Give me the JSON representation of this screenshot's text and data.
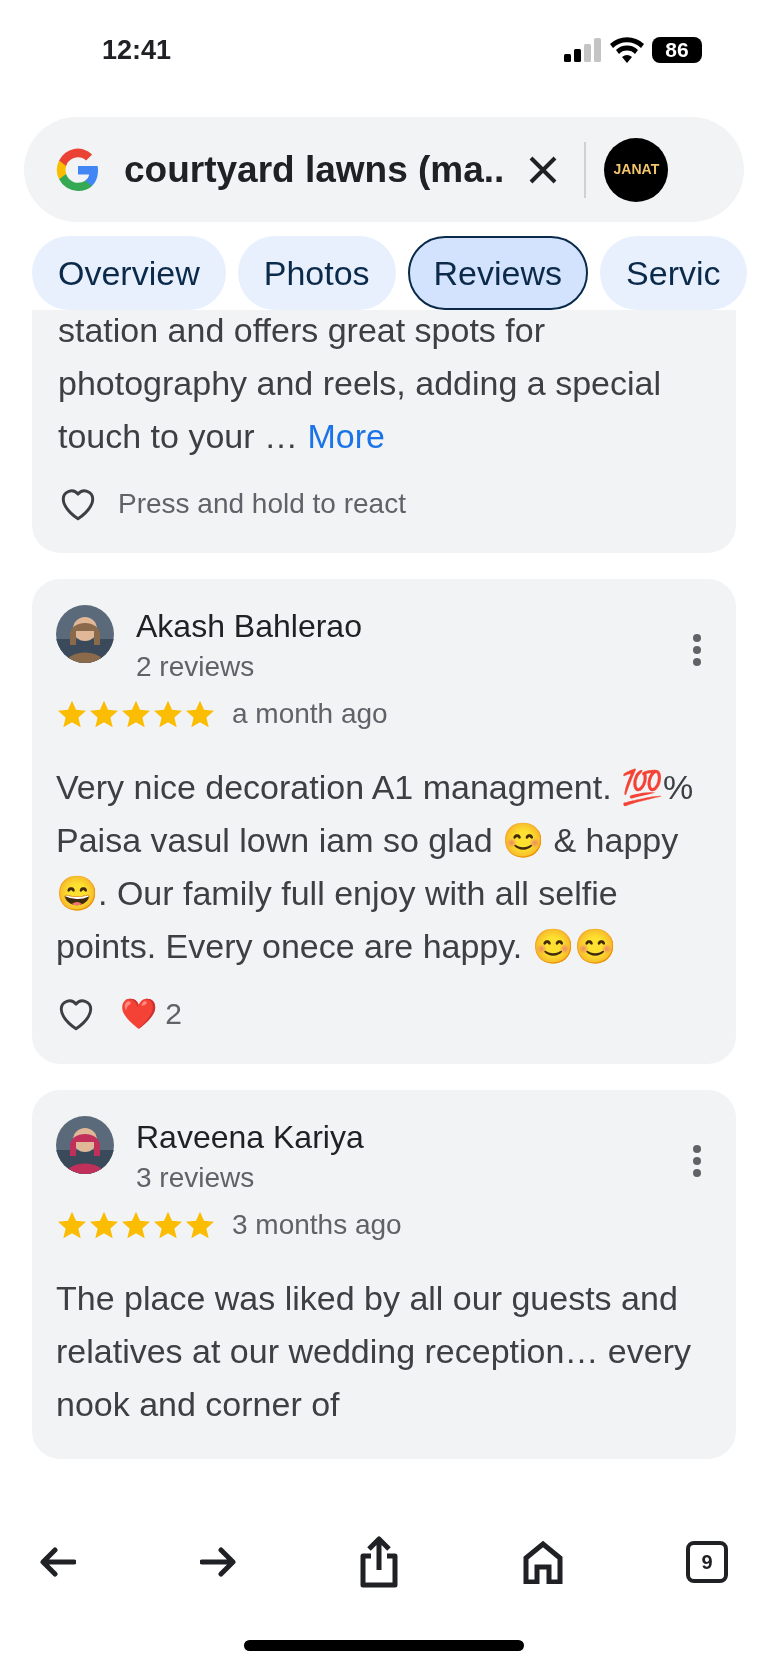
{
  "status_bar": {
    "time": "12:41",
    "battery": "86"
  },
  "search": {
    "query": "courtyard lawns (ma..",
    "profile_logo": "JANAT"
  },
  "tabs": [
    {
      "label": "Overview",
      "selected": false
    },
    {
      "label": "Photos",
      "selected": false
    },
    {
      "label": "Reviews",
      "selected": true
    },
    {
      "label": "Servic",
      "selected": false
    }
  ],
  "partial_review": {
    "text": "station and offers great spots for photography and reels, adding a special touch to your …",
    "more": "More",
    "react_prompt": "Press and hold to react"
  },
  "reviews": [
    {
      "name": "Akash Bahlerao",
      "count": "2 reviews",
      "stars": 5,
      "time": "a month ago",
      "text": "Very nice decoration A1 managment. 💯% Paisa vasul lown iam so glad 😊 & happy 😄. Our family full enjoy with all selfie points. Every onece are happy. 😊😊",
      "reaction": "❤️",
      "reaction_count": "2"
    },
    {
      "name": "Raveena Kariya",
      "count": "3 reviews",
      "stars": 5,
      "time": "3 months ago",
      "text": "The place was liked by all our guests and relatives at our wedding reception… every nook and corner of"
    }
  ],
  "toolbar": {
    "tab_count": "9"
  }
}
